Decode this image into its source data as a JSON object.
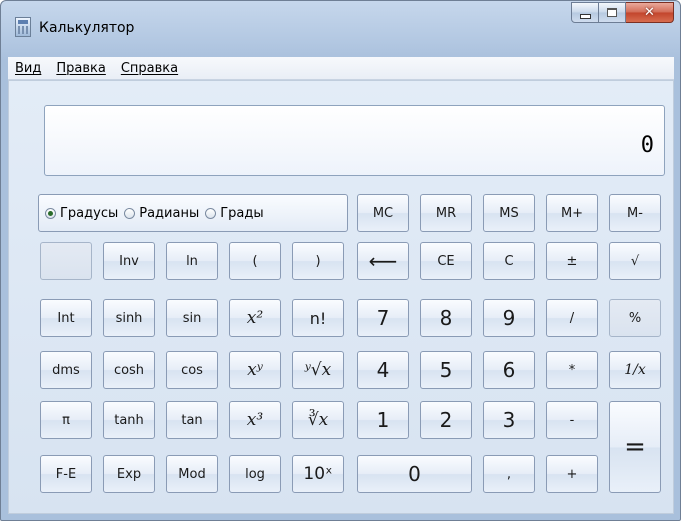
{
  "window": {
    "title": "Калькулятор"
  },
  "menu": [
    {
      "label": "Вид"
    },
    {
      "label": "Правка"
    },
    {
      "label": "Справка"
    }
  ],
  "display": {
    "value": "0"
  },
  "angle_units": {
    "options": [
      "Градусы",
      "Радианы",
      "Грады"
    ],
    "selected": "Градусы"
  },
  "buttons": {
    "memory": [
      "MC",
      "MR",
      "MS",
      "M+",
      "M-"
    ],
    "row2": [
      "",
      "Inv",
      "ln",
      "(",
      ")",
      "⟵",
      "CE",
      "C",
      "±",
      "√"
    ],
    "row3": [
      "Int",
      "sinh",
      "sin",
      "x²",
      "n!",
      "7",
      "8",
      "9",
      "/",
      "%"
    ],
    "row4": [
      "dms",
      "cosh",
      "cos",
      "xʸ",
      "ʸ√x",
      "4",
      "5",
      "6",
      "*",
      "1/x"
    ],
    "row5": [
      "π",
      "tanh",
      "tan",
      "x³",
      "∛x",
      "1",
      "2",
      "3",
      "-",
      "="
    ],
    "row6": [
      "F-E",
      "Exp",
      "Mod",
      "log",
      "10ˣ",
      "0",
      ",",
      "+"
    ]
  }
}
